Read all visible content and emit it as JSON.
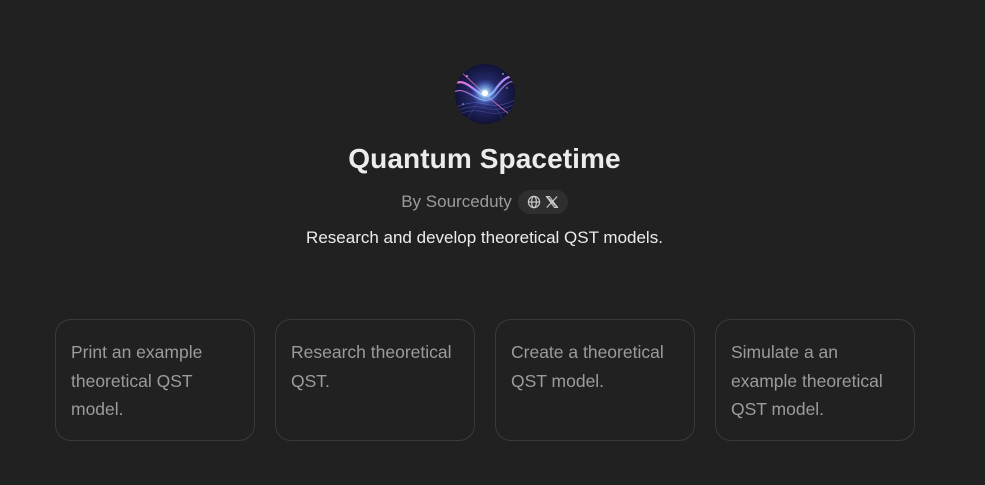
{
  "gpt": {
    "name": "Quantum Spacetime",
    "author": "By Sourceduty",
    "description": "Research and develop theoretical QST models."
  },
  "icons": {
    "avatar": "quantum-spacetime-avatar",
    "website": "globe-icon",
    "twitter": "x-icon"
  },
  "prompts": [
    {
      "text": "Print an example theoretical QST model."
    },
    {
      "text": "Research theoretical QST."
    },
    {
      "text": "Create a theoretical QST model."
    },
    {
      "text": "Simulate a an example theoretical QST model."
    }
  ],
  "colors": {
    "background": "#212121",
    "title": "#ececec",
    "muted": "#9b9b9b",
    "card_border": "#3a3a3a",
    "pill_background": "#2f2f2f"
  }
}
